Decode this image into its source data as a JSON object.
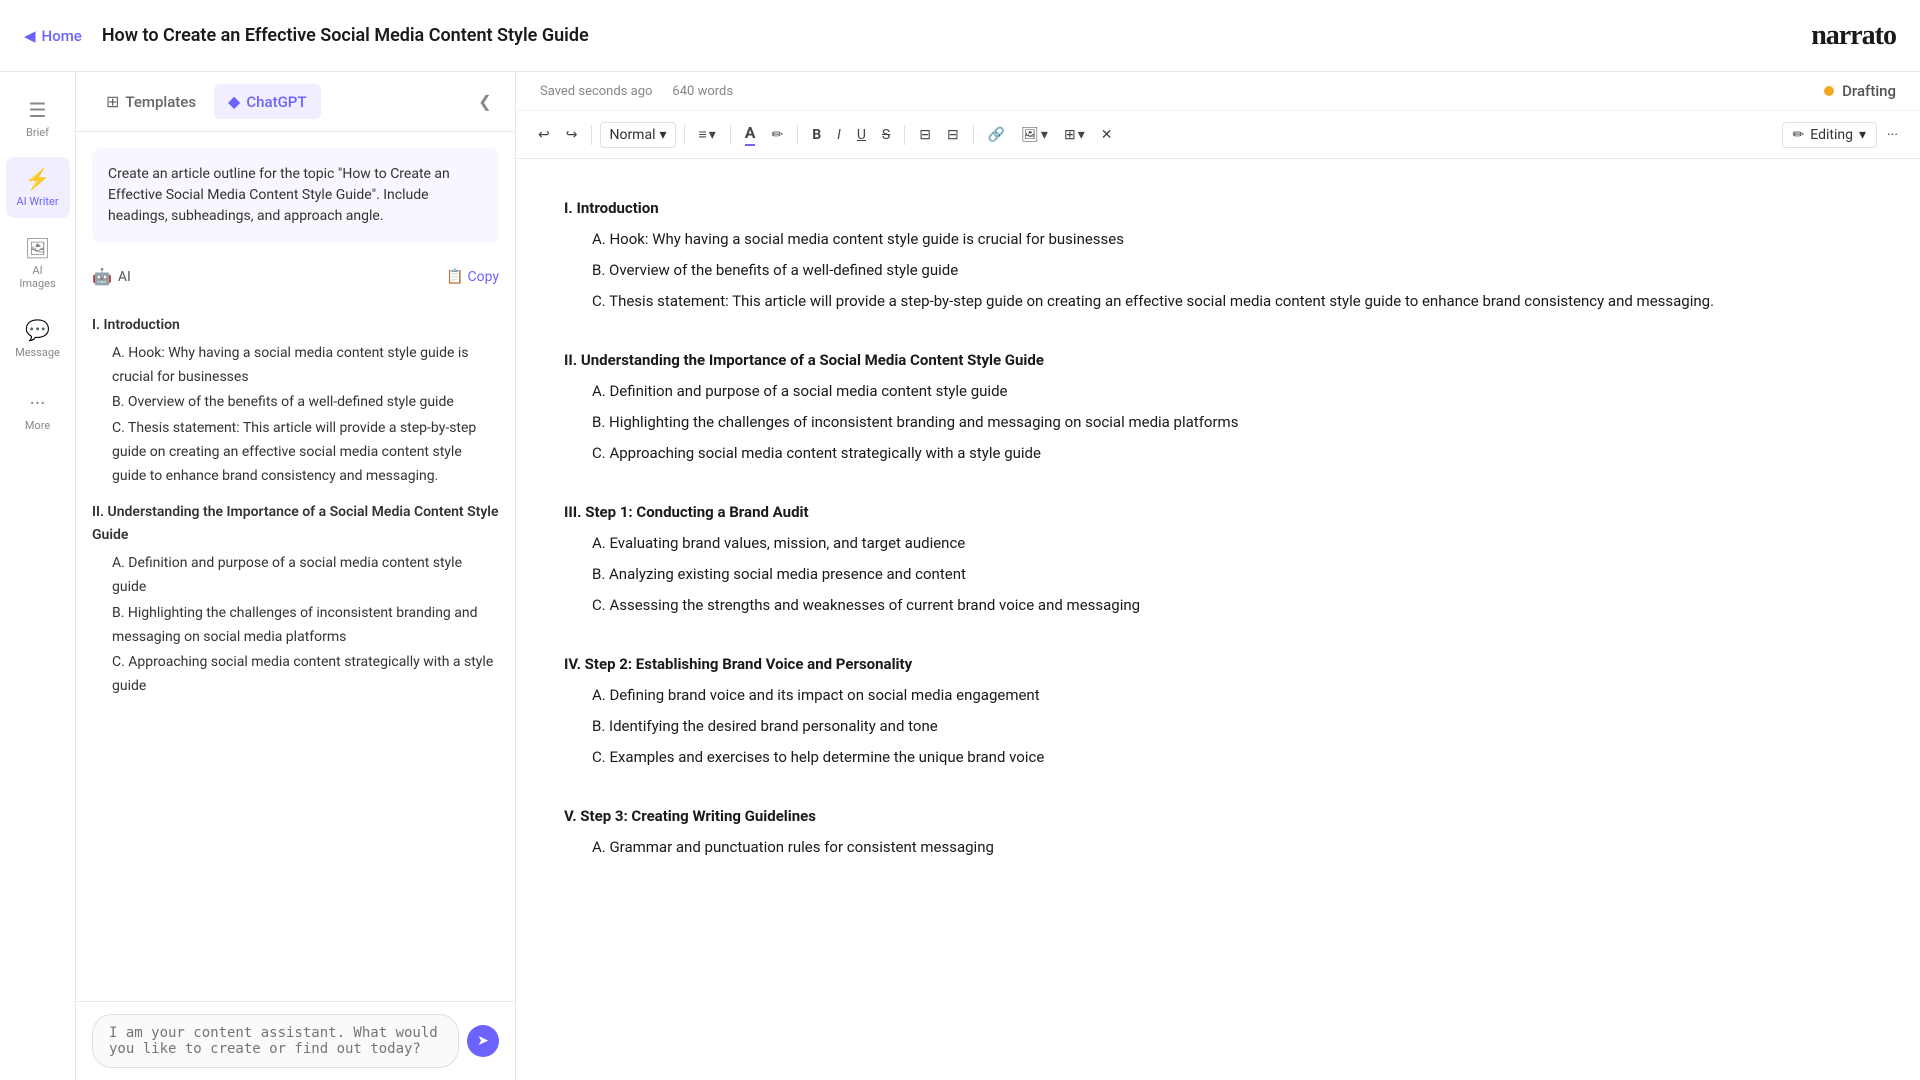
{
  "nav": {
    "home_label": "Home",
    "page_title": "How to Create an Effective Social Media Content Style Guide",
    "logo": "narrato"
  },
  "sidebar_icons": [
    {
      "id": "brief",
      "symbol": "☰",
      "label": "Brief",
      "active": false
    },
    {
      "id": "ai-writer",
      "symbol": "⚡",
      "label": "AI Writer",
      "active": true
    },
    {
      "id": "ai-images",
      "symbol": "🖼",
      "label": "AI Images",
      "active": false
    },
    {
      "id": "message",
      "symbol": "💬",
      "label": "Message",
      "active": false
    },
    {
      "id": "more",
      "symbol": "···",
      "label": "More",
      "active": false
    }
  ],
  "panel": {
    "tabs": [
      {
        "id": "templates",
        "icon": "⊞",
        "label": "Templates",
        "active": false
      },
      {
        "id": "chatgpt",
        "icon": "◆",
        "label": "ChatGPT",
        "active": true
      }
    ],
    "prompt_text": "Create an article outline for the topic \"How to Create an Effective Social Media Content Style Guide\". Include headings, subheadings, and approach angle.",
    "ai_label": "AI",
    "copy_label": "Copy",
    "outline": [
      {
        "type": "section",
        "text": "I. Introduction"
      },
      {
        "type": "sub",
        "text": "A. Hook: Why having a social media content style guide is crucial for businesses"
      },
      {
        "type": "sub",
        "text": "B. Overview of the benefits of a well-defined style guide"
      },
      {
        "type": "sub",
        "text": "C. Thesis statement: This article will provide a step-by-step guide on creating an effective social media content style guide to enhance brand consistency and messaging."
      },
      {
        "type": "section",
        "text": "II. Understanding the Importance of a Social Media Content Style Guide"
      },
      {
        "type": "sub",
        "text": "A. Definition and purpose of a social media content style guide"
      },
      {
        "type": "sub",
        "text": "B. Highlighting the challenges of inconsistent branding and messaging on social media platforms"
      },
      {
        "type": "sub",
        "text": "C. Approaching social media content strategically with a style guide"
      }
    ],
    "chat_placeholder": "I am your content assistant. What would you like to create or find out today?"
  },
  "editor": {
    "saved_text": "Saved seconds ago",
    "word_count": "640 words",
    "drafting_label": "Drafting",
    "toolbar": {
      "undo": "↩",
      "redo": "↪",
      "normal_style": "Normal",
      "align_icon": "≡",
      "text_color_icon": "A",
      "highlight_icon": "✏",
      "bold": "B",
      "italic": "I",
      "underline": "U",
      "strikethrough": "S",
      "bullet_list": "≡",
      "numbered_list": "≡",
      "link": "🔗",
      "image": "🖼",
      "table": "⊞",
      "clear": "✕",
      "edit_mode": "Editing",
      "more": "···"
    },
    "content": {
      "sections": [
        {
          "heading": "I. Introduction",
          "items": [
            "A. Hook: Why having a social media content style guide is crucial for businesses",
            "B. Overview of the benefits of a well-defined style guide",
            "C. Thesis statement: This article will provide a step-by-step guide on creating an effective social media content style guide to enhance brand consistency and messaging."
          ]
        },
        {
          "heading": "II. Understanding the Importance of a Social Media Content Style Guide",
          "items": [
            "A. Definition and purpose of a social media content style guide",
            "B. Highlighting the challenges of inconsistent branding and messaging on social media platforms",
            "C. Approaching social media content strategically with a style guide"
          ]
        },
        {
          "heading": "III. Step 1: Conducting a Brand Audit",
          "items": [
            "A. Evaluating brand values, mission, and target audience",
            "B. Analyzing existing social media presence and content",
            "C. Assessing the strengths and weaknesses of current brand voice and messaging"
          ]
        },
        {
          "heading": "IV. Step 2: Establishing Brand Voice and Personality",
          "items": [
            "A. Defining brand voice and its impact on social media engagement",
            "B. Identifying the desired brand personality and tone",
            "C. Examples and exercises to help determine the unique brand voice"
          ]
        },
        {
          "heading": "V. Step 3: Creating Writing Guidelines",
          "items": [
            "A. Grammar and punctuation rules for consistent messaging"
          ]
        }
      ]
    }
  }
}
